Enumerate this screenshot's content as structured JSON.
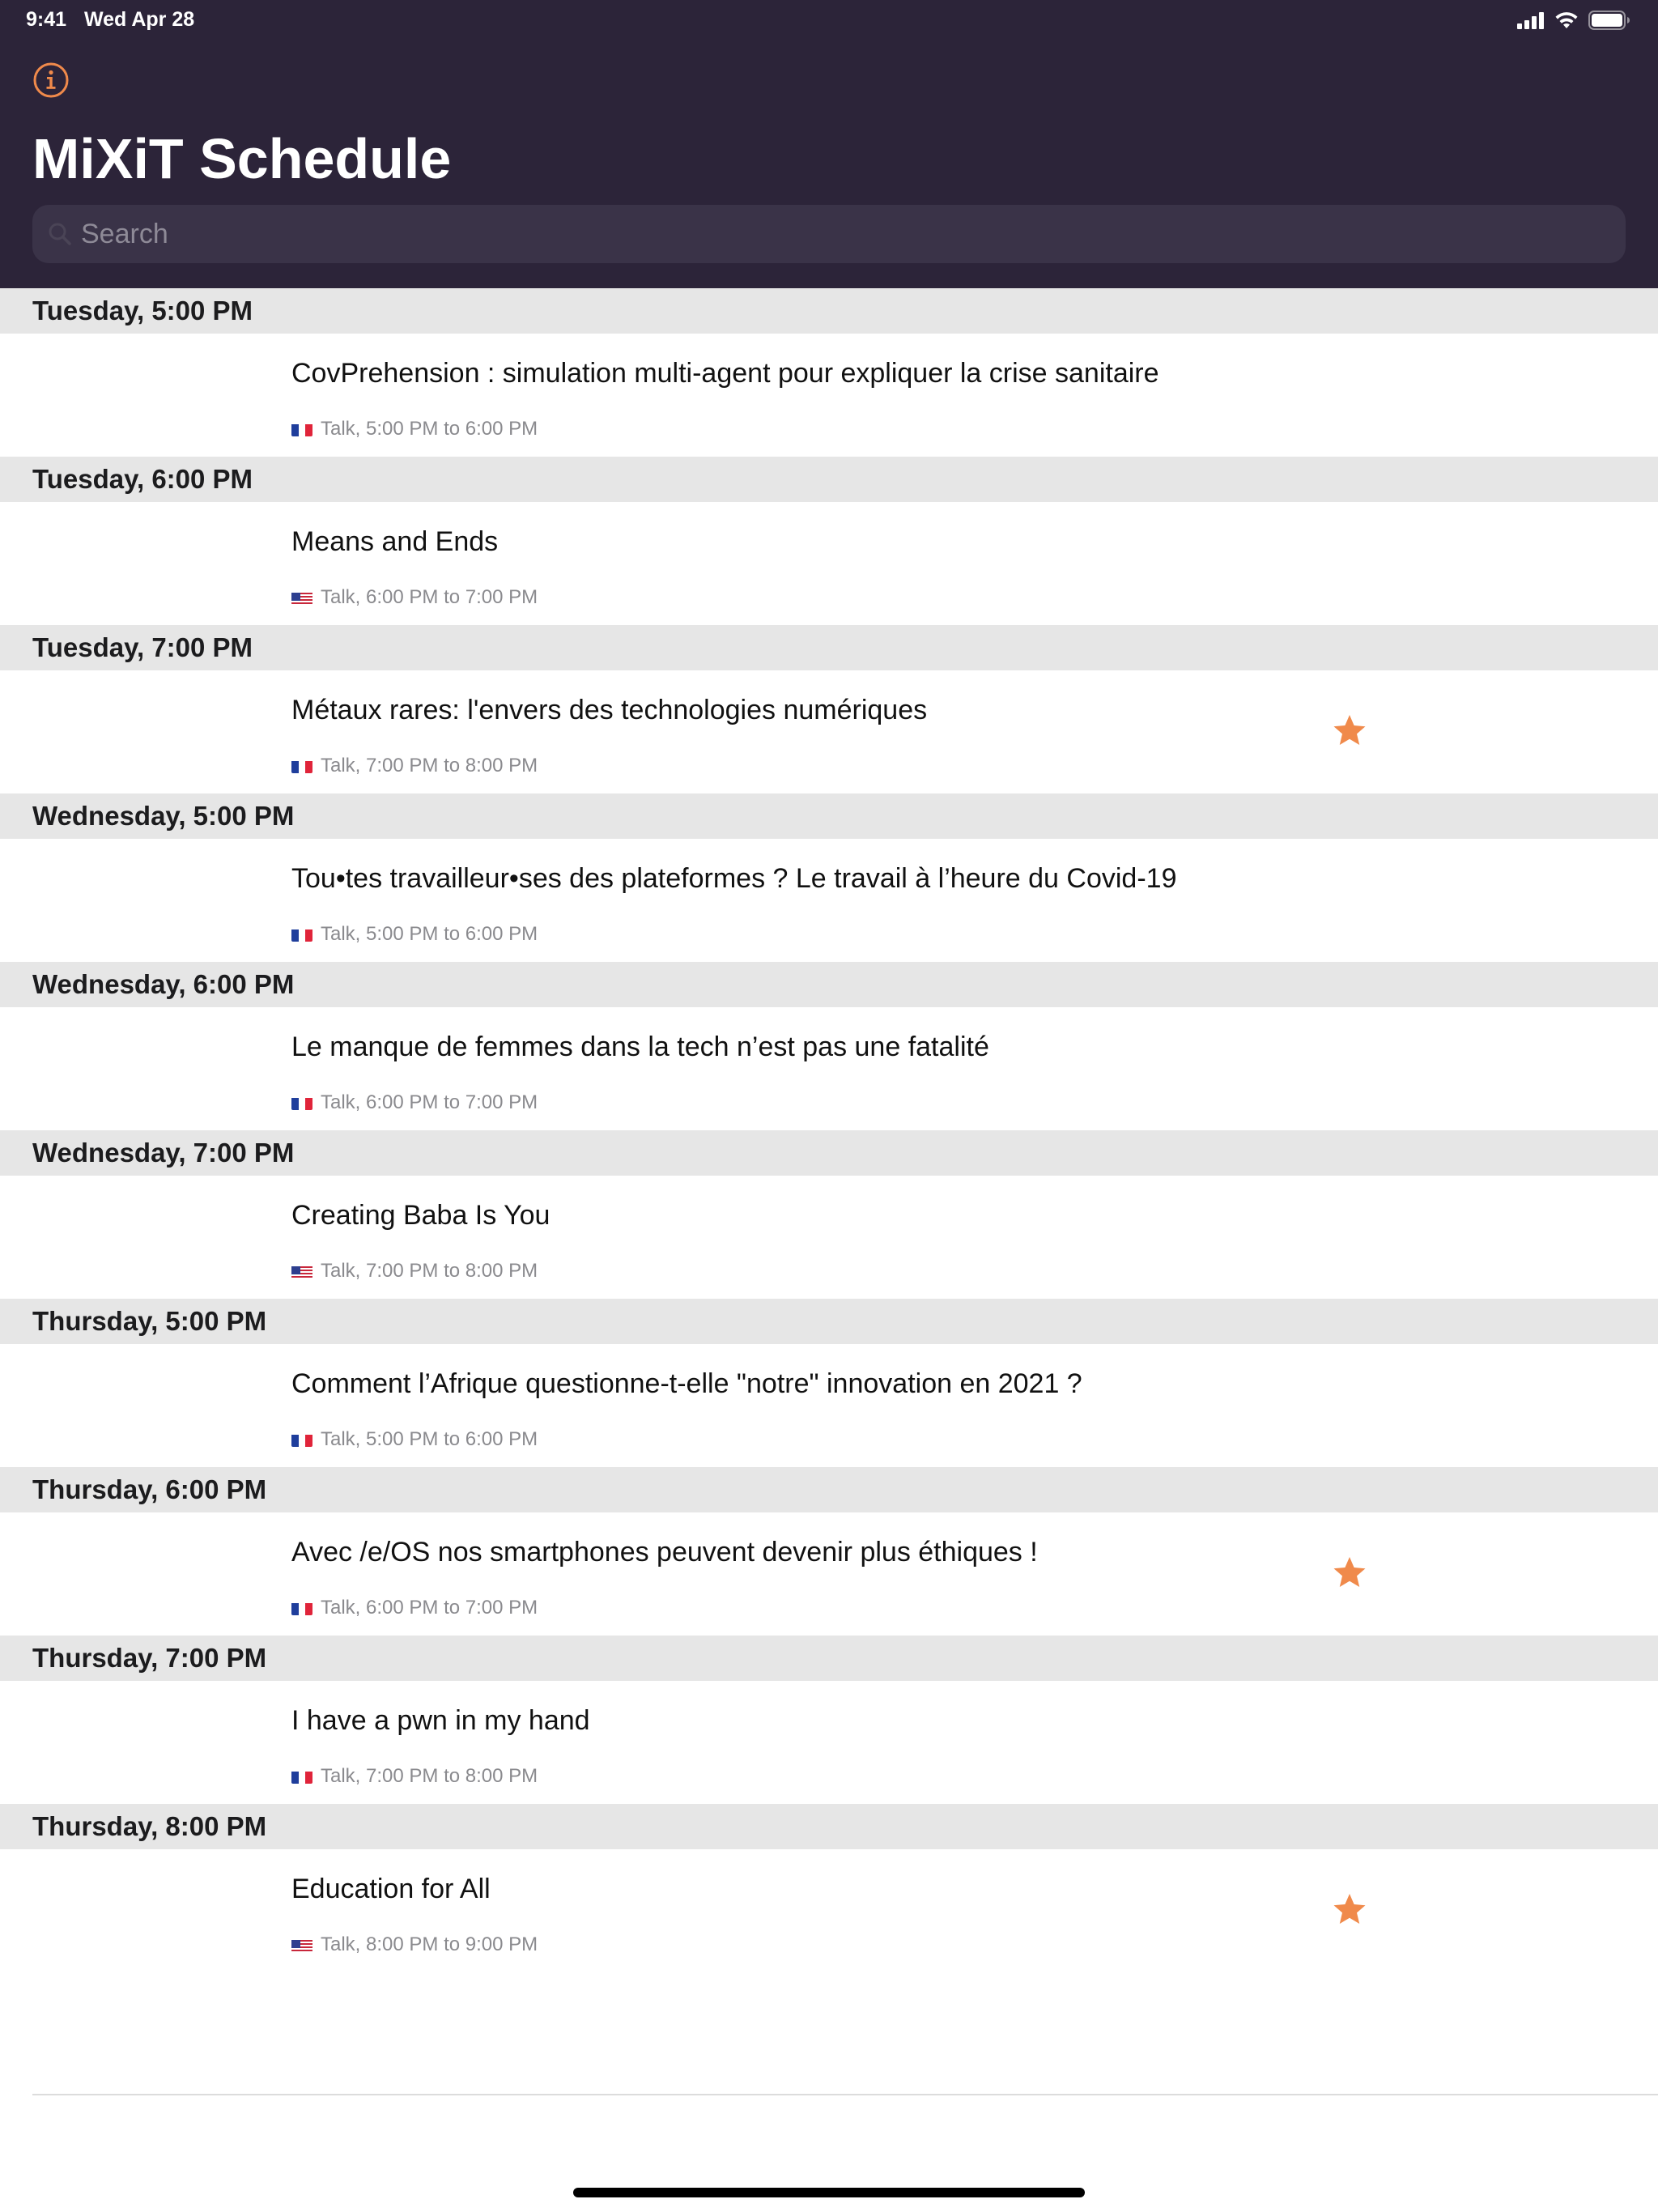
{
  "status_bar": {
    "time": "9:41",
    "date": "Wed Apr 28"
  },
  "header": {
    "title": "MiXiT Schedule",
    "search_placeholder": "Search",
    "accent_color": "#f08a4b",
    "background_color": "#2c2439"
  },
  "sections": [
    {
      "header": "Tuesday, 5:00 PM",
      "title": "CovPrehension : simulation multi-agent pour expliquer la crise sanitaire",
      "meta": "Talk, 5:00 PM to 6:00 PM",
      "flag": "fr-flag-icon",
      "favorite": false
    },
    {
      "header": "Tuesday, 6:00 PM",
      "title": "Means and Ends",
      "meta": "Talk, 6:00 PM to 7:00 PM",
      "flag": "us-flag-icon",
      "favorite": false
    },
    {
      "header": "Tuesday, 7:00 PM",
      "title": "Métaux rares: l'envers des technologies numériques",
      "meta": "Talk, 7:00 PM to 8:00 PM",
      "flag": "fr-flag-icon",
      "favorite": true
    },
    {
      "header": "Wednesday, 5:00 PM",
      "title": "Tou•tes travailleur•ses des plateformes ? Le travail à l’heure du Covid-19",
      "meta": "Talk, 5:00 PM to 6:00 PM",
      "flag": "fr-flag-icon",
      "favorite": false
    },
    {
      "header": "Wednesday, 6:00 PM",
      "title": "Le manque de femmes dans la tech n’est pas une fatalité",
      "meta": "Talk, 6:00 PM to 7:00 PM",
      "flag": "fr-flag-icon",
      "favorite": false
    },
    {
      "header": "Wednesday, 7:00 PM",
      "title": "Creating Baba Is You",
      "meta": "Talk, 7:00 PM to 8:00 PM",
      "flag": "us-flag-icon",
      "favorite": false
    },
    {
      "header": "Thursday, 5:00 PM",
      "title": "Comment l’Afrique questionne-t-elle \"notre\" innovation en 2021 ?",
      "meta": "Talk, 5:00 PM to 6:00 PM",
      "flag": "fr-flag-icon",
      "favorite": false
    },
    {
      "header": "Thursday, 6:00 PM",
      "title": "Avec /e/OS nos smartphones peuvent devenir plus éthiques !",
      "meta": "Talk, 6:00 PM to 7:00 PM",
      "flag": "fr-flag-icon",
      "favorite": true
    },
    {
      "header": "Thursday, 7:00 PM",
      "title": "I have a pwn in my hand",
      "meta": "Talk, 7:00 PM to 8:00 PM",
      "flag": "fr-flag-icon",
      "favorite": false
    },
    {
      "header": "Thursday, 8:00 PM",
      "title": "Education for All",
      "meta": "Talk, 8:00 PM to 9:00 PM",
      "flag": "us-flag-icon",
      "favorite": true
    }
  ]
}
